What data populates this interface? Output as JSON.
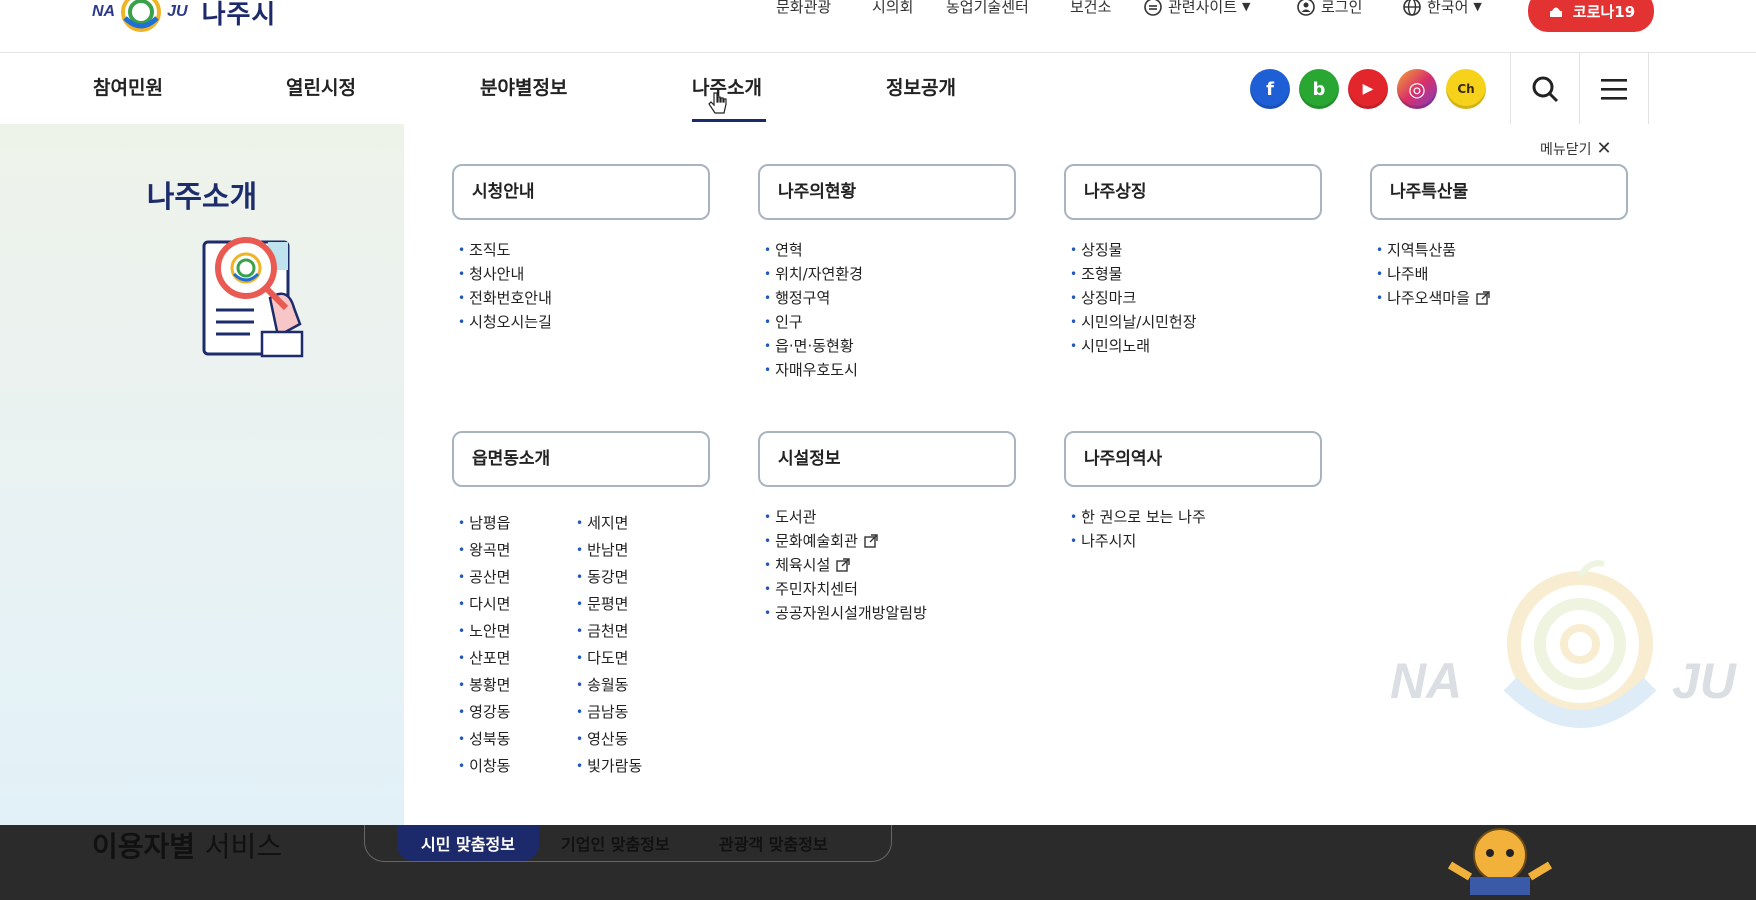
{
  "brand": {
    "logo_en_left": "NA",
    "logo_en_right": "JU",
    "logo_ko": "나주시"
  },
  "utility": {
    "items": [
      "문화관광",
      "시의회",
      "농업기술센터",
      "보건소"
    ],
    "related_sites": "관련사이트",
    "login": "로그인",
    "language": "한국어",
    "corona": "코로나19"
  },
  "nav": {
    "items": [
      "참여민원",
      "열린시정",
      "분야별정보",
      "나주소개",
      "정보공개"
    ],
    "active": "나주소개"
  },
  "sns": [
    {
      "name": "facebook",
      "glyph": "f",
      "color": "#1f5fd6"
    },
    {
      "name": "blog",
      "glyph": "b",
      "color": "#2aa733"
    },
    {
      "name": "youtube",
      "glyph": "▶",
      "color": "#e3262c"
    },
    {
      "name": "instagram",
      "glyph": "◎",
      "color": "#d8306b"
    },
    {
      "name": "kakao-channel",
      "glyph": "Ch",
      "color": "#f7d21b"
    }
  ],
  "panel": {
    "title": "나주소개",
    "close_label": "메뉴닫기",
    "categories": [
      {
        "title": "시청안내",
        "links": [
          "조직도",
          "청사안내",
          "전화번호안내",
          "시청오시는길"
        ]
      },
      {
        "title": "나주의현황",
        "links": [
          "연혁",
          "위치/자연환경",
          "행정구역",
          "인구",
          "읍·면·동현황",
          "자매우호도시"
        ]
      },
      {
        "title": "나주상징",
        "links": [
          "상징물",
          "조형물",
          "상징마크",
          "시민의날/시민헌장",
          "시민의노래"
        ]
      },
      {
        "title": "나주특산물",
        "links": [
          "지역특산품",
          "나주배",
          "나주오색마을"
        ]
      },
      {
        "title": "읍면동소개",
        "links_col1": [
          "남평읍",
          "왕곡면",
          "공산면",
          "다시면",
          "노안면",
          "산포면",
          "봉황면",
          "영강동",
          "성북동",
          "이창동"
        ],
        "links_col2": [
          "세지면",
          "반남면",
          "동강면",
          "문평면",
          "금천면",
          "다도면",
          "송월동",
          "금남동",
          "영산동",
          "빛가람동"
        ]
      },
      {
        "title": "시설정보",
        "links": [
          "도서관",
          "문화예술회관",
          "체육시설",
          "주민자치센터",
          "공공자원시설개방알림방"
        ]
      },
      {
        "title": "나주의역사",
        "links": [
          "한 권으로 보는 나주",
          "나주시지"
        ]
      }
    ]
  },
  "bottom": {
    "title_bold": "이용자별",
    "title_light": "서비스",
    "tabs": [
      "시민 맞춤정보",
      "기업인 맞춤정보",
      "관광객 맞춤정보"
    ]
  },
  "watermark": {
    "left": "NA",
    "right": "JU"
  }
}
